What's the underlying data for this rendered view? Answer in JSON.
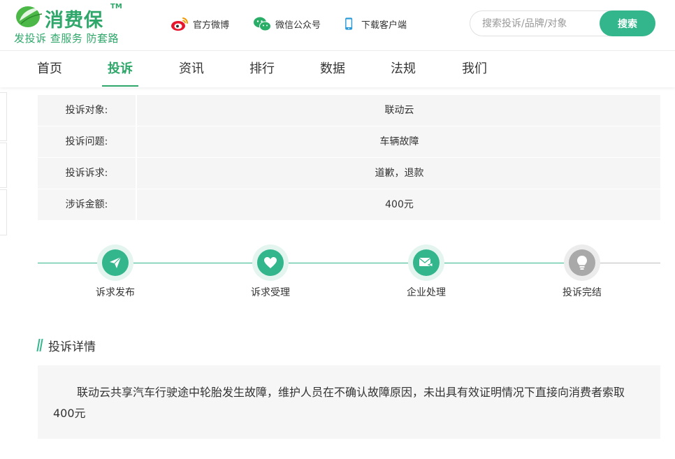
{
  "header": {
    "logo": {
      "name": "消费保",
      "tm": "TM",
      "slogan": "发投诉 查服务 防套路",
      "brand_color": "#2fa76a"
    },
    "links": [
      {
        "label": "官方微博",
        "icon": "weibo-icon"
      },
      {
        "label": "微信公众号",
        "icon": "wechat-icon"
      },
      {
        "label": "下载客户端",
        "icon": "phone-icon"
      }
    ],
    "search": {
      "placeholder": "搜索投诉/品牌/对象",
      "value": "",
      "button_label": "搜索",
      "button_color": "#33b68c"
    }
  },
  "nav": {
    "items": [
      "首页",
      "投诉",
      "资讯",
      "排行",
      "数据",
      "法规",
      "我们"
    ],
    "active": "投诉"
  },
  "complaint_info": [
    {
      "label": "投诉对象:",
      "value": "联动云"
    },
    {
      "label": "投诉问题:",
      "value": "车辆故障"
    },
    {
      "label": "投诉诉求:",
      "value": "道歉，退款"
    },
    {
      "label": "涉诉金额:",
      "value": "400元"
    }
  ],
  "progress": {
    "steps": [
      {
        "label": "诉求发布",
        "icon": "paper-plane-icon",
        "done": true
      },
      {
        "label": "诉求受理",
        "icon": "heart-icon",
        "done": true
      },
      {
        "label": "企业处理",
        "icon": "envelope-reply-icon",
        "done": true
      },
      {
        "label": "投诉完结",
        "icon": "lightbulb-icon",
        "done": false
      }
    ],
    "done_color": "#33b68c",
    "pending_color": "#a9a9a9"
  },
  "detail": {
    "title": "投诉详情",
    "text": "联动云共享汽车行驶途中轮胎发生故障，维护人员在不确认故障原因，未出具有效证明情况下直接向消费者索取400元"
  }
}
